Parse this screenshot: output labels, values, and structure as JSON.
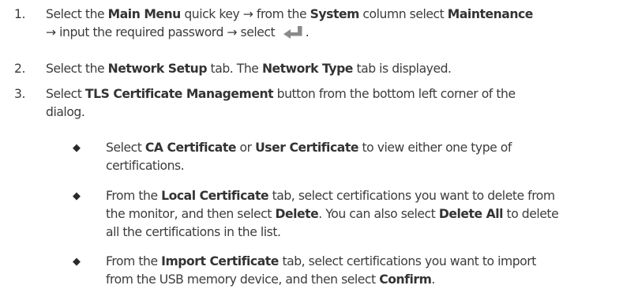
{
  "steps": [
    {
      "number": "1.",
      "segments": [
        {
          "t": "Select the ",
          "b": false
        },
        {
          "t": "Main Menu",
          "b": true
        },
        {
          "t": " quick key → from the ",
          "b": false
        },
        {
          "t": "System",
          "b": true
        },
        {
          "t": " column select ",
          "b": false
        },
        {
          "t": "Maintenance",
          "b": true
        },
        {
          "t": "\n→ input the required password → select",
          "b": false
        }
      ],
      "trailing_icon": "enter-key-icon",
      "trailing_text": "."
    },
    {
      "number": "2.",
      "segments": [
        {
          "t": "Select the ",
          "b": false
        },
        {
          "t": "Network Setup",
          "b": true
        },
        {
          "t": " tab. The ",
          "b": false
        },
        {
          "t": "Network Type",
          "b": true
        },
        {
          "t": " tab is displayed.",
          "b": false
        }
      ]
    },
    {
      "number": "3.",
      "segments": [
        {
          "t": "Select ",
          "b": false
        },
        {
          "t": "TLS Certificate Management",
          "b": true
        },
        {
          "t": " button from the bottom left corner of the\ndialog.",
          "b": false
        }
      ]
    }
  ],
  "bullets": [
    {
      "marker": "◆",
      "segments": [
        {
          "t": "Select ",
          "b": false
        },
        {
          "t": "CA Certificate",
          "b": true
        },
        {
          "t": " or ",
          "b": false
        },
        {
          "t": "User Certificate",
          "b": true
        },
        {
          "t": " to view either one type of\ncertifications.",
          "b": false
        }
      ]
    },
    {
      "marker": "◆",
      "segments": [
        {
          "t": "From the ",
          "b": false
        },
        {
          "t": "Local Certificate",
          "b": true
        },
        {
          "t": " tab, select certifications you want to delete from\nthe monitor, and then select ",
          "b": false
        },
        {
          "t": "Delete",
          "b": true
        },
        {
          "t": ". You can also select ",
          "b": false
        },
        {
          "t": "Delete All",
          "b": true
        },
        {
          "t": " to delete\nall the certifications in the list.",
          "b": false
        }
      ]
    },
    {
      "marker": "◆",
      "segments": [
        {
          "t": "From the ",
          "b": false
        },
        {
          "t": "Import Certificate",
          "b": true
        },
        {
          "t": " tab, select certifications you want to import\nfrom the USB memory device, and then select ",
          "b": false
        },
        {
          "t": "Confirm",
          "b": true
        },
        {
          "t": ".",
          "b": false
        }
      ]
    }
  ],
  "colors": {
    "text": "#3c3c3c",
    "icon": "#8a8a8a"
  }
}
